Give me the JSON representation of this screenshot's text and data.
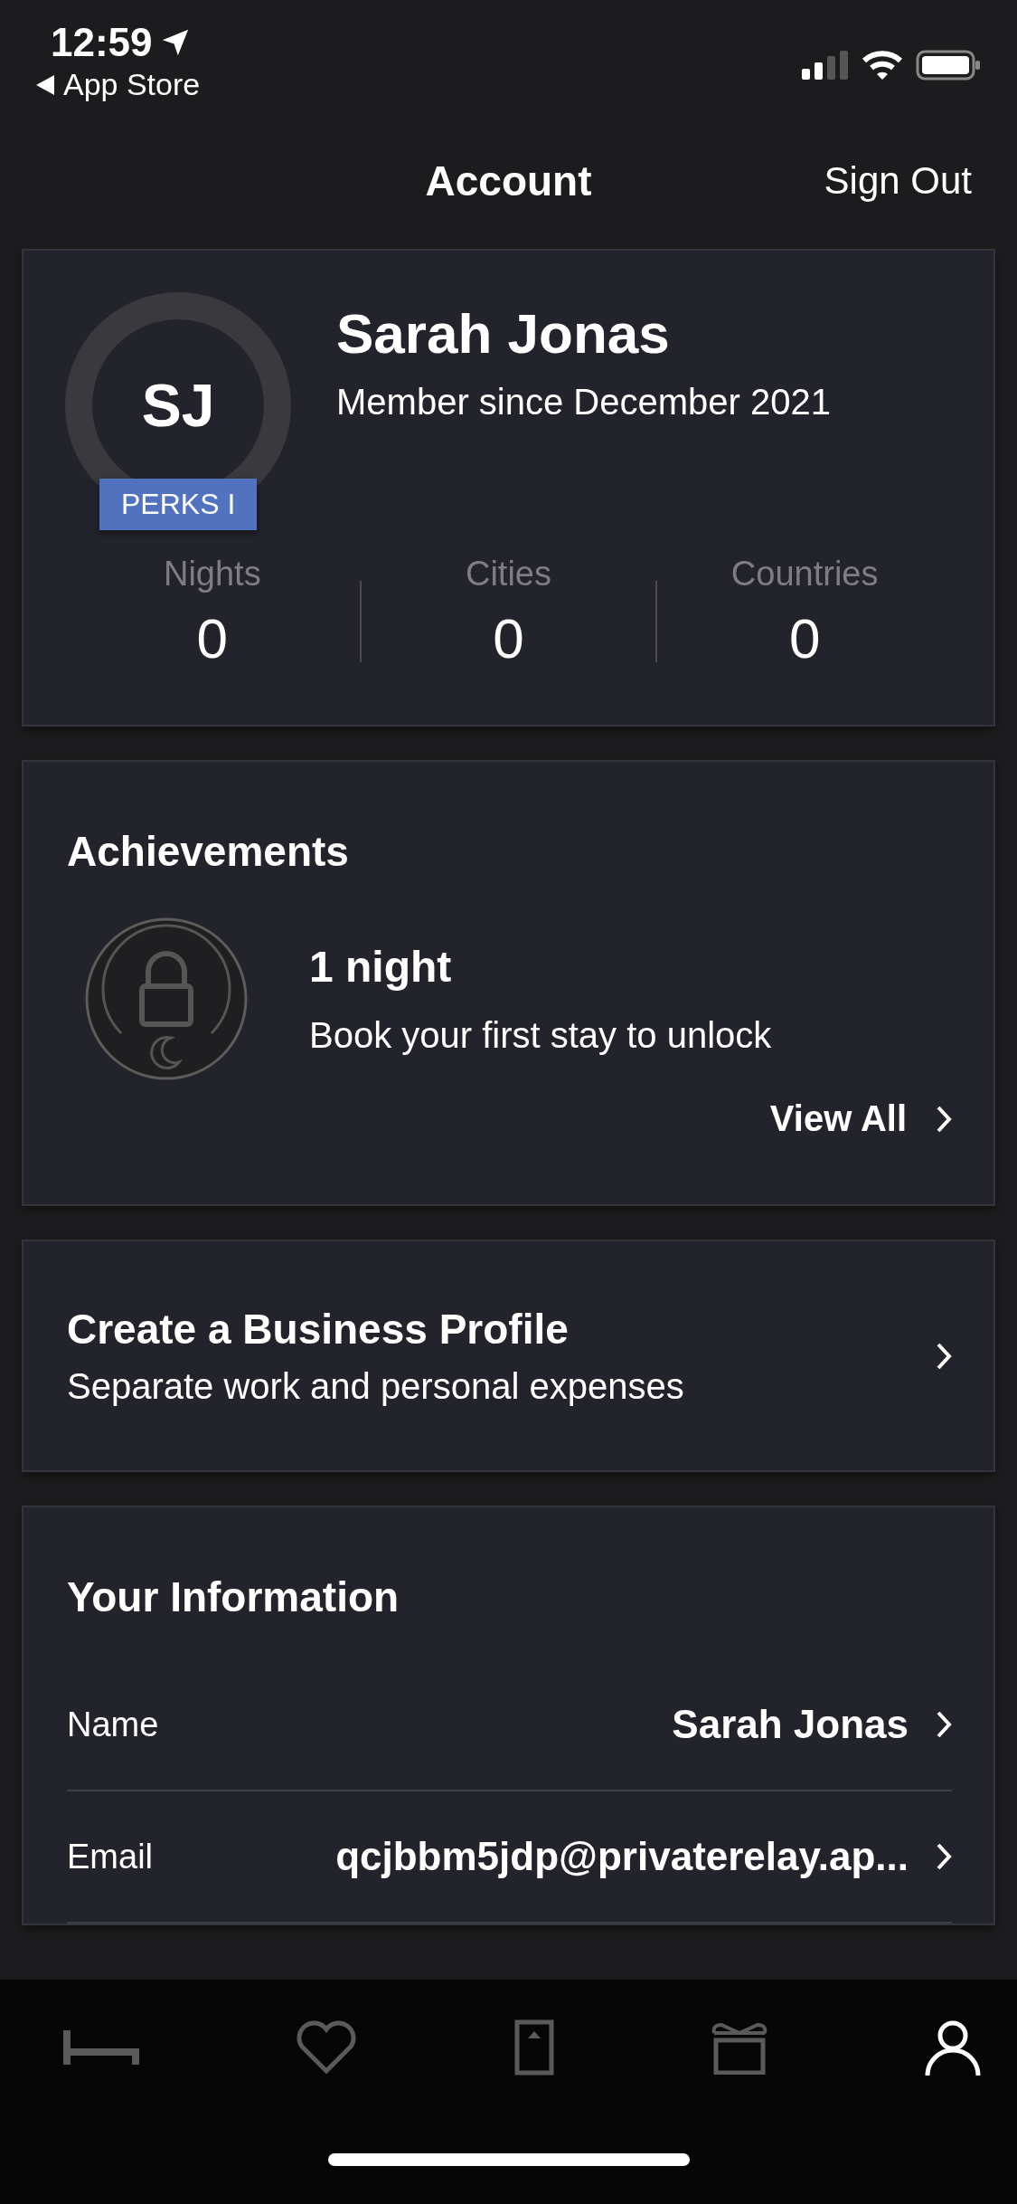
{
  "status_bar": {
    "time": "12:59",
    "back_label": "App Store"
  },
  "nav": {
    "title": "Account",
    "action": "Sign Out"
  },
  "profile": {
    "initials": "SJ",
    "tier": "PERKS I",
    "name": "Sarah Jonas",
    "member_since": "Member since December 2021",
    "stats": [
      {
        "label": "Nights",
        "value": "0"
      },
      {
        "label": "Cities",
        "value": "0"
      },
      {
        "label": "Countries",
        "value": "0"
      }
    ]
  },
  "achievements": {
    "title": "Achievements",
    "item": {
      "title": "1 night",
      "subtitle": "Book your first stay to unlock",
      "locked": true
    },
    "view_all": "View All"
  },
  "business_profile": {
    "title": "Create a Business Profile",
    "subtitle": "Separate work and personal expenses"
  },
  "your_information": {
    "title": "Your Information",
    "rows": [
      {
        "label": "Name",
        "value": "Sarah Jonas"
      },
      {
        "label": "Email",
        "value": "qcjbbm5jdp@privaterelay.ap..."
      }
    ]
  },
  "tab_bar": [
    {
      "kind": "bed",
      "selected": false
    },
    {
      "kind": "heart",
      "selected": false
    },
    {
      "kind": "door",
      "selected": false
    },
    {
      "kind": "gift",
      "selected": false
    },
    {
      "kind": "person",
      "selected": true
    }
  ]
}
